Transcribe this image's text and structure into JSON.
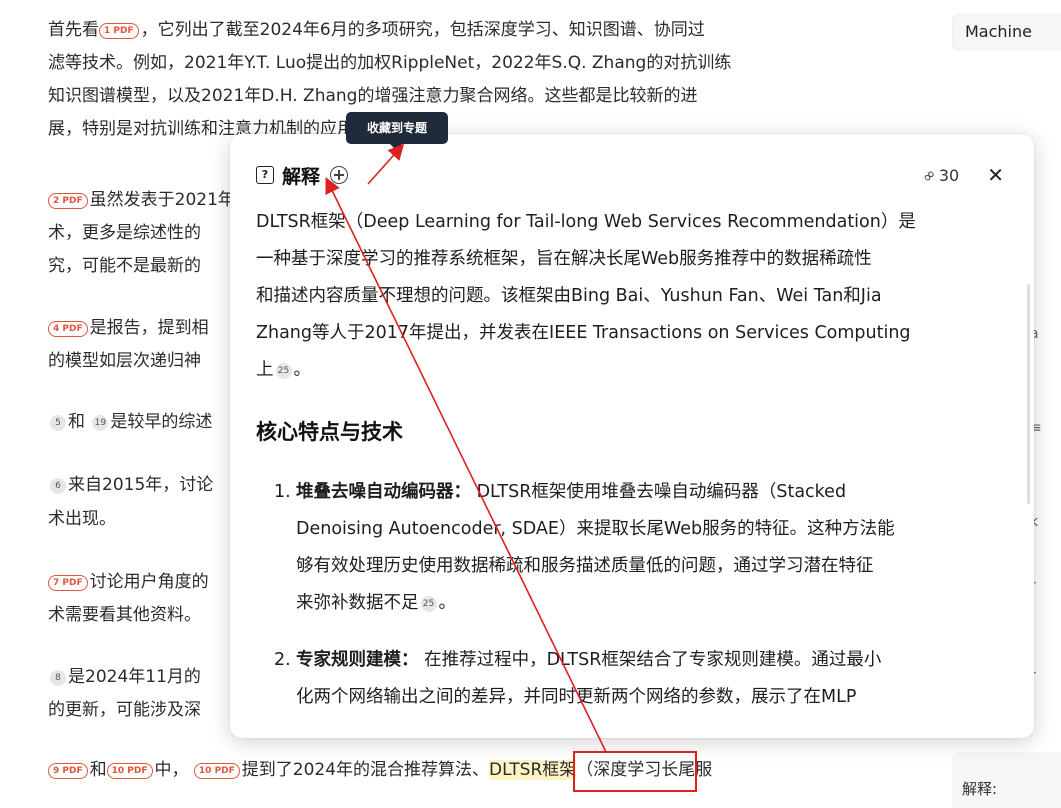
{
  "background": {
    "lines": [
      {
        "pre_cite": "",
        "cite": "",
        "text": "首先看",
        "cite2": "1 PDF",
        "text2": "，它列出了截至2024年6月的多项研究，包括深度学习、知识图谱、协同过"
      },
      {
        "text": "滤等技术。例如，2021年Y.T. Luo提出的加权RippleNet，2022年S.Q. Zhang的对抗训练"
      },
      {
        "text": "知识图谱模型，以及2021年D.H. Zhang的增强注意力聚合网络。这些都是比较新的进"
      },
      {
        "text": "展，特别是对抗训练和注意力机制的应用。"
      }
    ],
    "p2": {
      "cite": "2 PDF",
      "l1": "虽然发表于2021年",
      "l2": "术，更多是综述性的",
      "l3": "究，可能不是最新的"
    },
    "p3": {
      "cite": "4 PDF",
      "l1": "是报告，提到相",
      "l2": "的模型如层次递归神"
    },
    "p4": {
      "n1": "5",
      "mid": "和",
      "n2": "19",
      "l1": "是较早的综述"
    },
    "p5": {
      "n1": "6",
      "l1": "来自2015年，讨论",
      "l2": "术出现。"
    },
    "p6": {
      "cite": "7 PDF",
      "l1": "讨论用户角度的",
      "l2": "术需要看其他资料。"
    },
    "p7": {
      "n1": "8",
      "l1": "是2024年11月的",
      "l2": "的更新，可能涉及深"
    },
    "p8": {
      "cite1": "9 PDF",
      "mid": "和",
      "cite2": "10 PDF",
      "mid2": "中，",
      "cite3": "10 PDF",
      "l1": "提到了2024年的混合推荐算法、",
      "hl": "DLTSR框架",
      "l2": "（深度学习长尾服"
    }
  },
  "right_chip": "Machine",
  "bottom_chip": "解释:",
  "right_edge": [
    "a",
    "≡",
    "k",
    "r",
    "r"
  ],
  "tooltip": "收藏到专题",
  "popup": {
    "title": "解释",
    "q_icon": "?",
    "link_count": "30",
    "body": [
      "DLTSR框架（Deep Learning for Tail-long Web Services Recommendation）是",
      "一种基于深度学习的推荐系统框架，旨在解决长尾Web服务推荐中的数据稀疏性",
      "和描述内容质量不理想的问题。该框架由Bing Bai、Yushun Fan、Wei Tan和Jia",
      "Zhang等人于2017年提出，并发表在IEEE Transactions on Services Computing",
      "上"
    ],
    "body_ref": "25",
    "body_end": "。",
    "heading": "核心特点与技术",
    "items": [
      {
        "num": "1.",
        "bold": "堆叠去噪自动编码器",
        "colon": "：",
        "lines": [
          "DLTSR框架使用堆叠去噪自动编码器（Stacked",
          "Denoising Autoencoder, SDAE）来提取长尾Web服务的特征。这种方法能",
          "够有效处理历史使用数据稀疏和服务描述质量低的问题，通过学习潜在特征",
          "来弥补数据不足"
        ],
        "ref": "25",
        "end": "。"
      },
      {
        "num": "2.",
        "bold": "专家规则建模",
        "colon": "：",
        "lines": [
          "在推荐过程中，DLTSR框架结合了专家规则建模。通过最小",
          "化两个网络输出之间的差异，并同时更新两个网络的参数，展示了在MLP"
        ]
      }
    ]
  },
  "colors": {
    "cite": "#e0563b",
    "annotation": "#e02020",
    "tooltip_bg": "#1f2a3b"
  }
}
